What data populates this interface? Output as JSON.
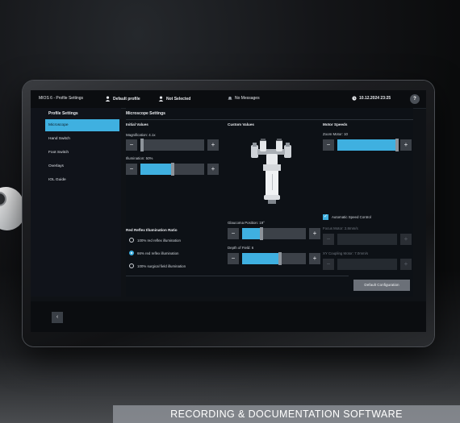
{
  "topbar": {
    "app_title": "MIOS 6 - Profile Settings",
    "profile_label": "Default profile",
    "selection_label": "Not Selected",
    "messages_label": "No Messages",
    "datetime": "10.12.2024 23:25",
    "help_label": "?"
  },
  "sidebar": {
    "title": "Profile Settings",
    "items": [
      {
        "label": "Microscope",
        "active": true
      },
      {
        "label": "Hand Switch",
        "active": false
      },
      {
        "label": "Foot Switch",
        "active": false
      },
      {
        "label": "Overlays",
        "active": false
      },
      {
        "label": "IOL Guide",
        "active": false
      }
    ]
  },
  "main": {
    "title": "Microscope Settings",
    "initial_values": {
      "heading": "Initial Values",
      "magnification_label": "Magnification: 4.1x",
      "magnification_level": 0.03,
      "illumination_label": "Illumination: 50%",
      "illumination_level": 0.5
    },
    "custom_values": {
      "heading": "Custom Values",
      "glaucoma_label": "Glaucoma Position: 19°",
      "glaucoma_level": 0.3,
      "depth_label": "Depth of Field: 6",
      "depth_level": 0.6
    },
    "motor_speeds": {
      "heading": "Motor Speeds",
      "zoom_label": "Zoom Motor: 10",
      "zoom_level": 1.0,
      "auto_speed_label": "Automatic Speed Control",
      "focus_label": "Focus Motor: 2.8mm/s",
      "xy_label": "XY Coupling Motor: 7.0mm/s"
    },
    "red_reflex": {
      "heading": "Red Reflex Illumination Ratio",
      "options": [
        {
          "label": "100% red reflex illumination",
          "selected": false
        },
        {
          "label": "66% red reflex illumination",
          "selected": true
        },
        {
          "label": "100% surgical field illumination",
          "selected": false
        }
      ]
    },
    "default_button_label": "Default Configuration",
    "minus_glyph": "−",
    "plus_glyph": "+"
  },
  "back_glyph": "‹",
  "footer_text": "RECORDING & DOCUMENTATION SOFTWARE",
  "colors": {
    "accent": "#3fb0e0",
    "background": "#0f1216"
  }
}
